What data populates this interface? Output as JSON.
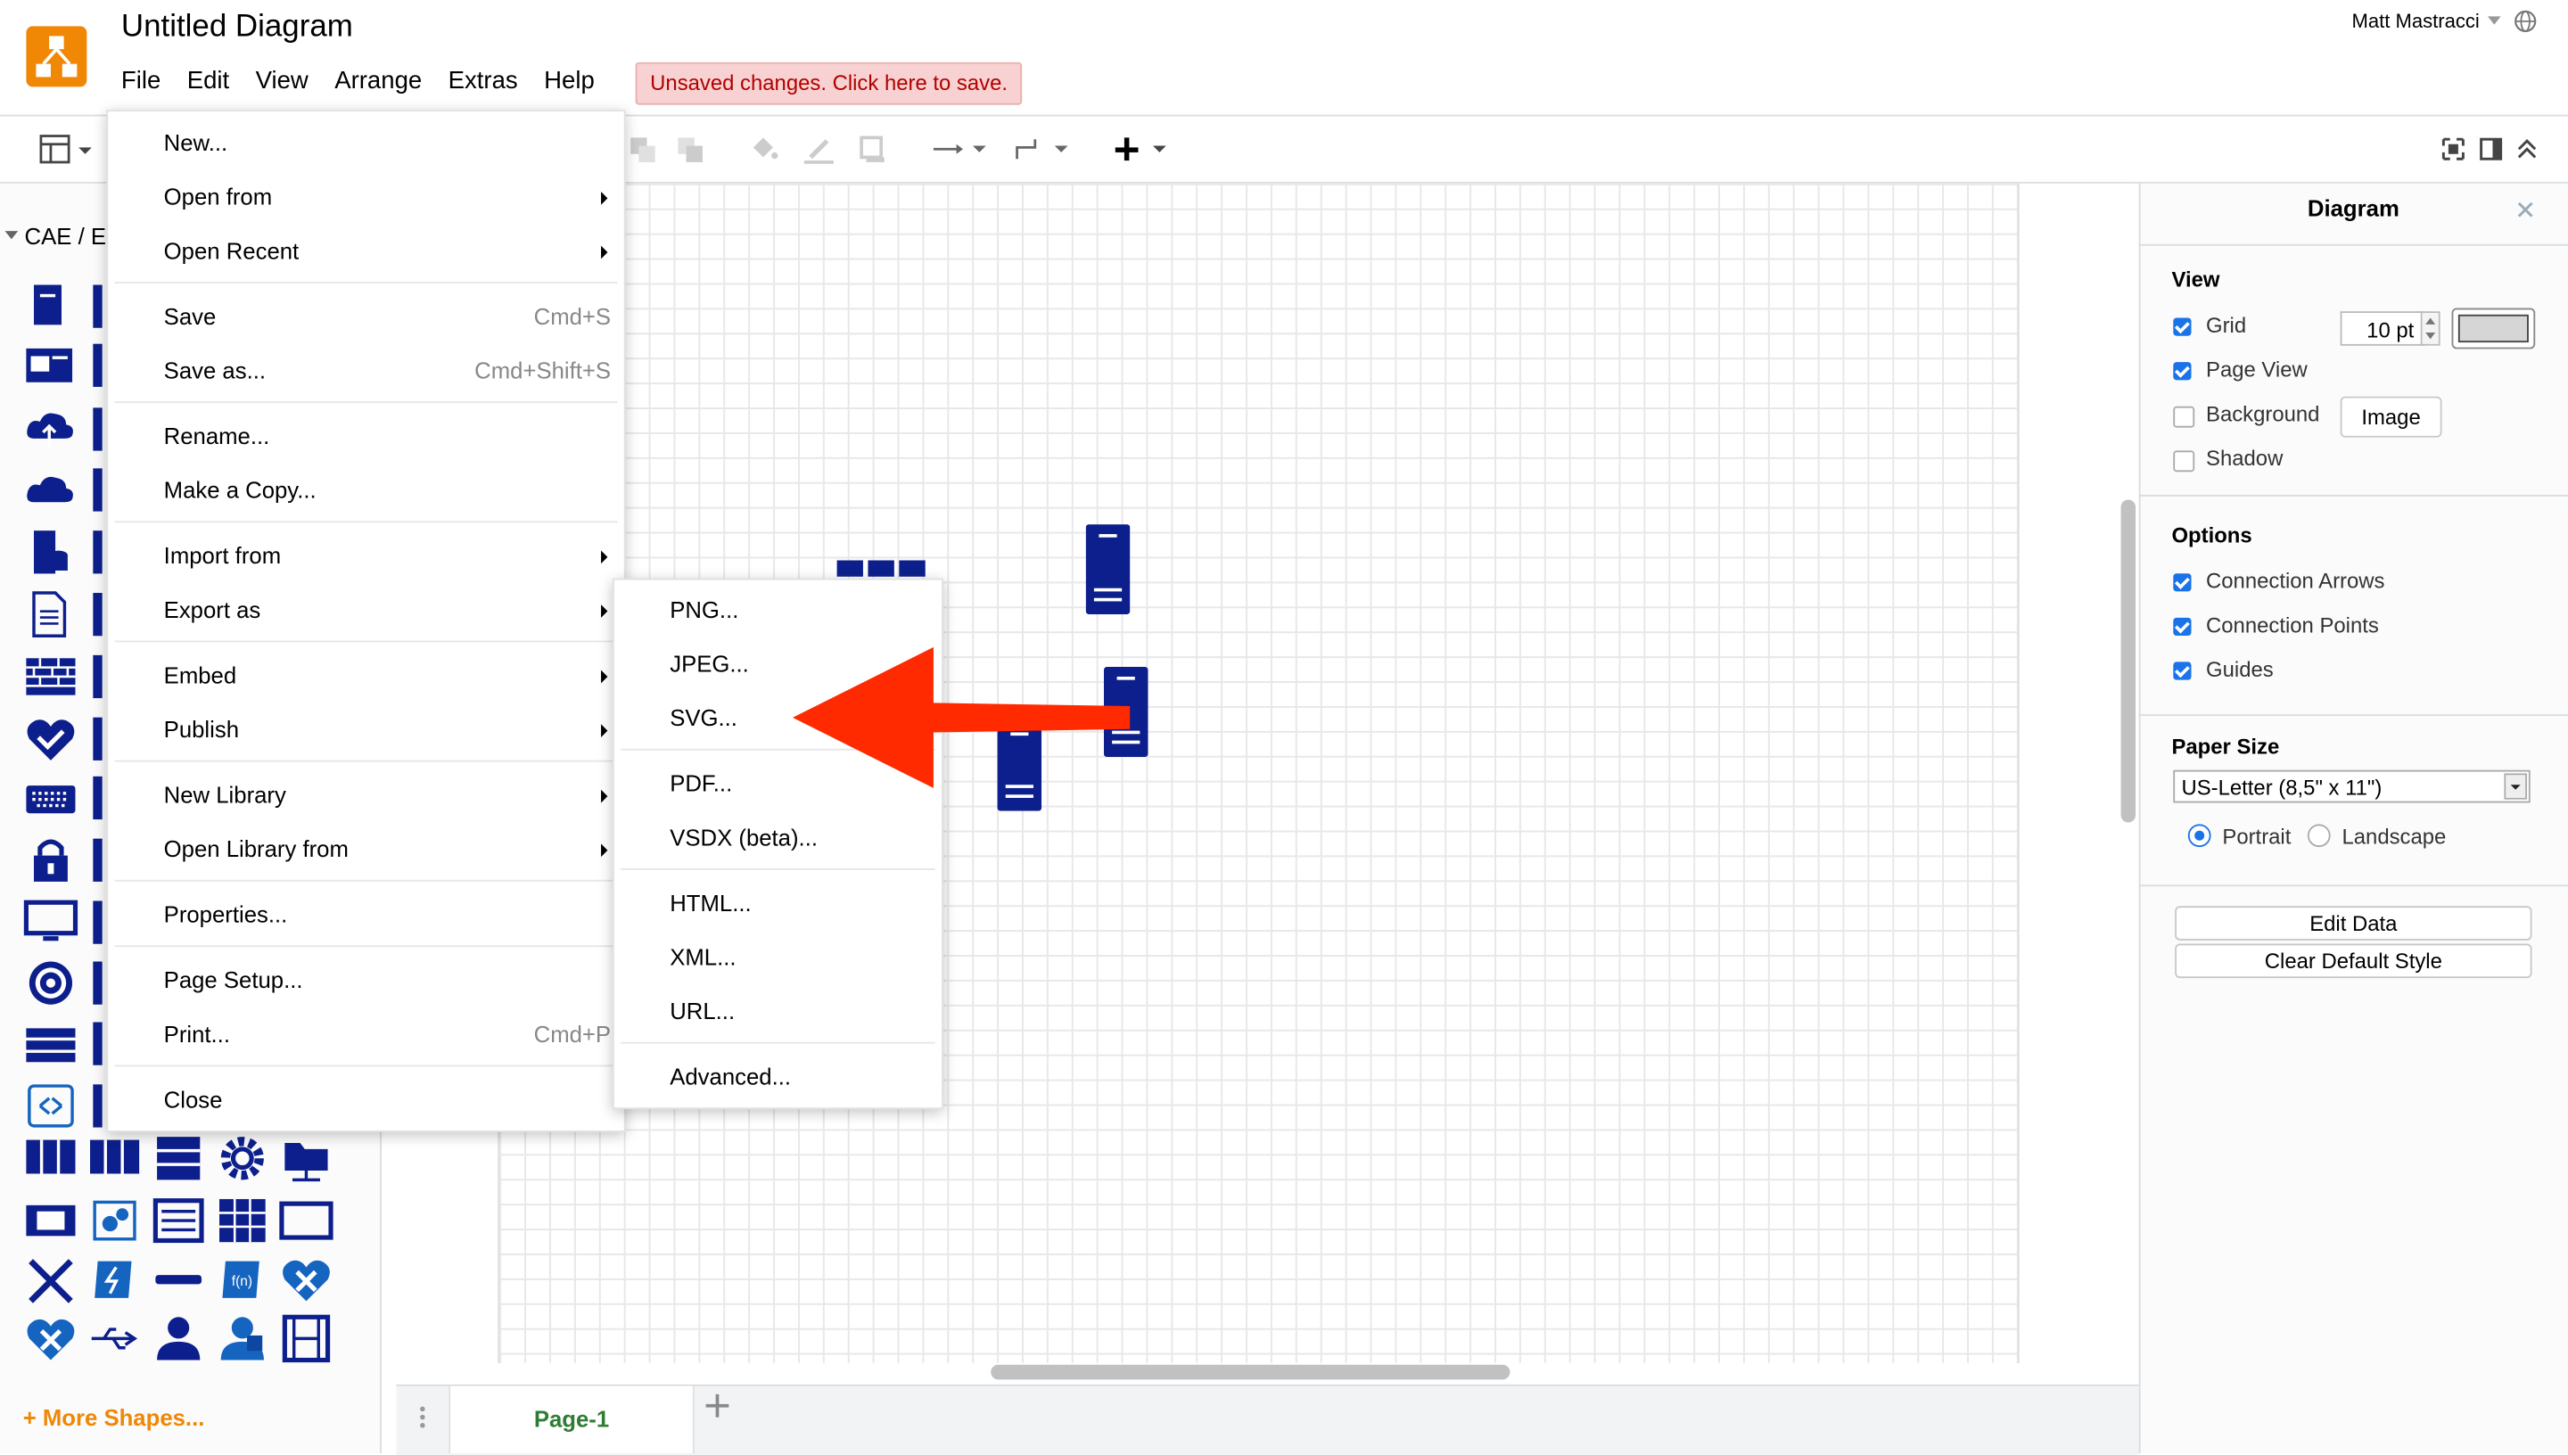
{
  "app": {
    "title": "Untitled Diagram",
    "user": "Matt Mastracci",
    "unsaved_notice": "Unsaved changes. Click here to save."
  },
  "menubar": {
    "items": [
      "File",
      "Edit",
      "View",
      "Arrange",
      "Extras",
      "Help"
    ]
  },
  "colors": {
    "accent": "#f08705",
    "shape_blue": "#0d1f8c",
    "arrow_red": "#ff2a00",
    "unsaved_bg": "#f8d2d2",
    "check_blue": "#1a73e8"
  },
  "left_panel": {
    "category": "CAE / E",
    "more_shapes": "+ More Shapes..."
  },
  "file_menu": {
    "items": [
      {
        "label": "New...",
        "shortcut": "",
        "submenu": false
      },
      {
        "label": "Open from",
        "shortcut": "",
        "submenu": true
      },
      {
        "label": "Open Recent",
        "shortcut": "",
        "submenu": true
      },
      {
        "label": "Save",
        "shortcut": "Cmd+S",
        "submenu": false
      },
      {
        "label": "Save as...",
        "shortcut": "Cmd+Shift+S",
        "submenu": false
      },
      {
        "label": "Rename...",
        "shortcut": "",
        "submenu": false
      },
      {
        "label": "Make a Copy...",
        "shortcut": "",
        "submenu": false
      },
      {
        "label": "Import from",
        "shortcut": "",
        "submenu": true
      },
      {
        "label": "Export as",
        "shortcut": "",
        "submenu": true
      },
      {
        "label": "Embed",
        "shortcut": "",
        "submenu": true
      },
      {
        "label": "Publish",
        "shortcut": "",
        "submenu": true
      },
      {
        "label": "New Library",
        "shortcut": "",
        "submenu": true
      },
      {
        "label": "Open Library from",
        "shortcut": "",
        "submenu": true
      },
      {
        "label": "Properties...",
        "shortcut": "",
        "submenu": false
      },
      {
        "label": "Page Setup...",
        "shortcut": "",
        "submenu": false
      },
      {
        "label": "Print...",
        "shortcut": "Cmd+P",
        "submenu": false
      },
      {
        "label": "Close",
        "shortcut": "",
        "submenu": false
      }
    ]
  },
  "export_menu": {
    "items": [
      "PNG...",
      "JPEG...",
      "SVG...",
      "PDF...",
      "VSDX (beta)...",
      "HTML...",
      "XML...",
      "URL...",
      "Advanced..."
    ]
  },
  "right_panel": {
    "title": "Diagram",
    "view": {
      "heading": "View",
      "grid": {
        "label": "Grid",
        "checked": true,
        "size": "10 pt"
      },
      "page_view": {
        "label": "Page View",
        "checked": true
      },
      "background": {
        "label": "Background",
        "checked": false,
        "button": "Image"
      },
      "shadow": {
        "label": "Shadow",
        "checked": false
      }
    },
    "options": {
      "heading": "Options",
      "connection_arrows": {
        "label": "Connection Arrows",
        "checked": true
      },
      "connection_points": {
        "label": "Connection Points",
        "checked": true
      },
      "guides": {
        "label": "Guides",
        "checked": true
      }
    },
    "paper": {
      "heading": "Paper Size",
      "size": "US-Letter (8,5\" x 11\")",
      "portrait": "Portrait",
      "landscape": "Landscape",
      "orientation": "portrait"
    },
    "buttons": {
      "edit_data": "Edit Data",
      "clear_default_style": "Clear Default Style"
    }
  },
  "tabs": {
    "pages": [
      "Page-1"
    ],
    "active": "Page-1"
  }
}
